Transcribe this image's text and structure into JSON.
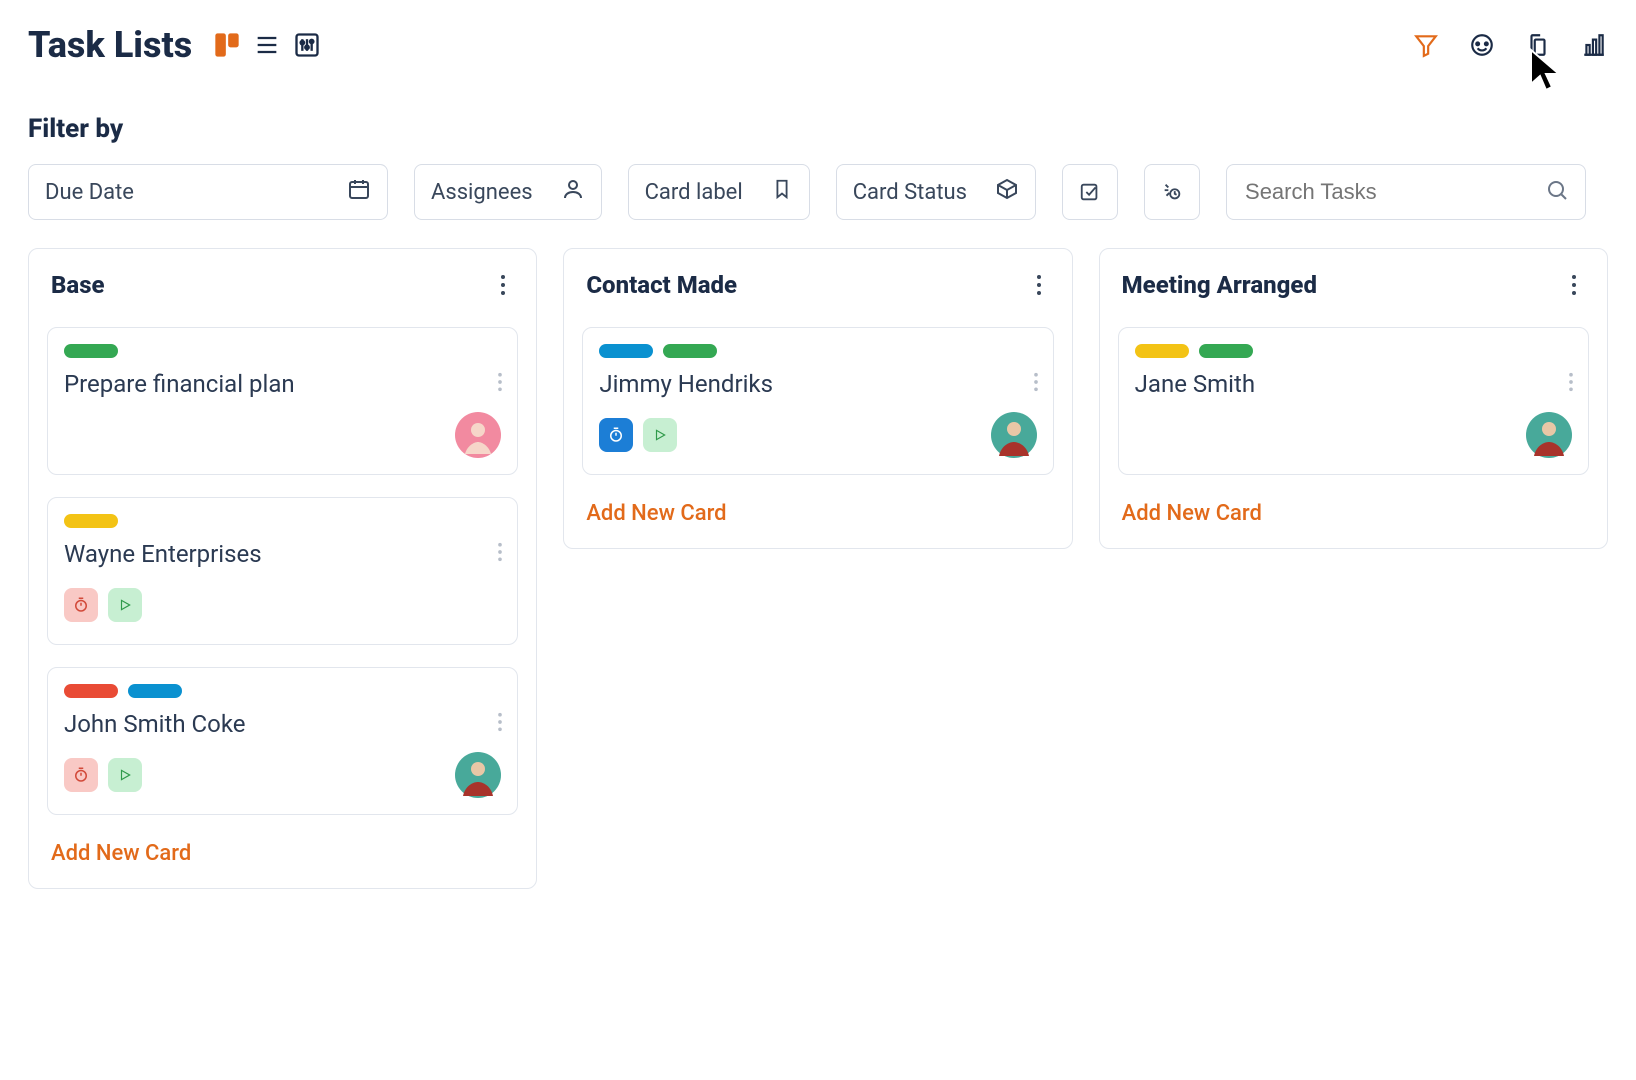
{
  "header": {
    "title": "Task Lists"
  },
  "filter": {
    "label": "Filter by",
    "due_date": "Due Date",
    "assignees": "Assignees",
    "card_label": "Card label",
    "card_status": "Card Status",
    "search_placeholder": "Search Tasks"
  },
  "board": {
    "add_card_label": "Add New Card",
    "columns": [
      {
        "title": "Base",
        "cards": [
          {
            "title": "Prepare financial plan",
            "tags": [
              "green"
            ],
            "badges": [],
            "avatar": "pink"
          },
          {
            "title": "Wayne Enterprises",
            "tags": [
              "yellow"
            ],
            "badges": [
              "timer-red",
              "play-green"
            ],
            "avatar": null
          },
          {
            "title": "John Smith Coke",
            "tags": [
              "red",
              "blue"
            ],
            "badges": [
              "timer-red",
              "play-green"
            ],
            "avatar": "teal"
          }
        ]
      },
      {
        "title": "Contact Made",
        "cards": [
          {
            "title": "Jimmy Hendriks",
            "tags": [
              "blue",
              "green"
            ],
            "badges": [
              "timer-blue",
              "play-green"
            ],
            "avatar": "teal"
          }
        ]
      },
      {
        "title": "Meeting Arranged",
        "cards": [
          {
            "title": "Jane Smith",
            "tags": [
              "yellow",
              "green"
            ],
            "badges": [],
            "avatar": "teal"
          }
        ]
      }
    ]
  },
  "colors": {
    "green": "#34a853",
    "blue": "#0a91d0",
    "yellow": "#f3c315",
    "red": "#e94b35",
    "accent": "#e26a1a",
    "badge_red_bg": "#f9c9c5",
    "badge_red_fg": "#d24a3a",
    "badge_green_bg": "#c7efd2",
    "badge_green_fg": "#2f9a4a",
    "badge_blue_bg": "#1c7ed6",
    "badge_blue_fg": "#ffffff",
    "avatar_pink": "#f28aa0",
    "avatar_teal": "#48a99a"
  }
}
